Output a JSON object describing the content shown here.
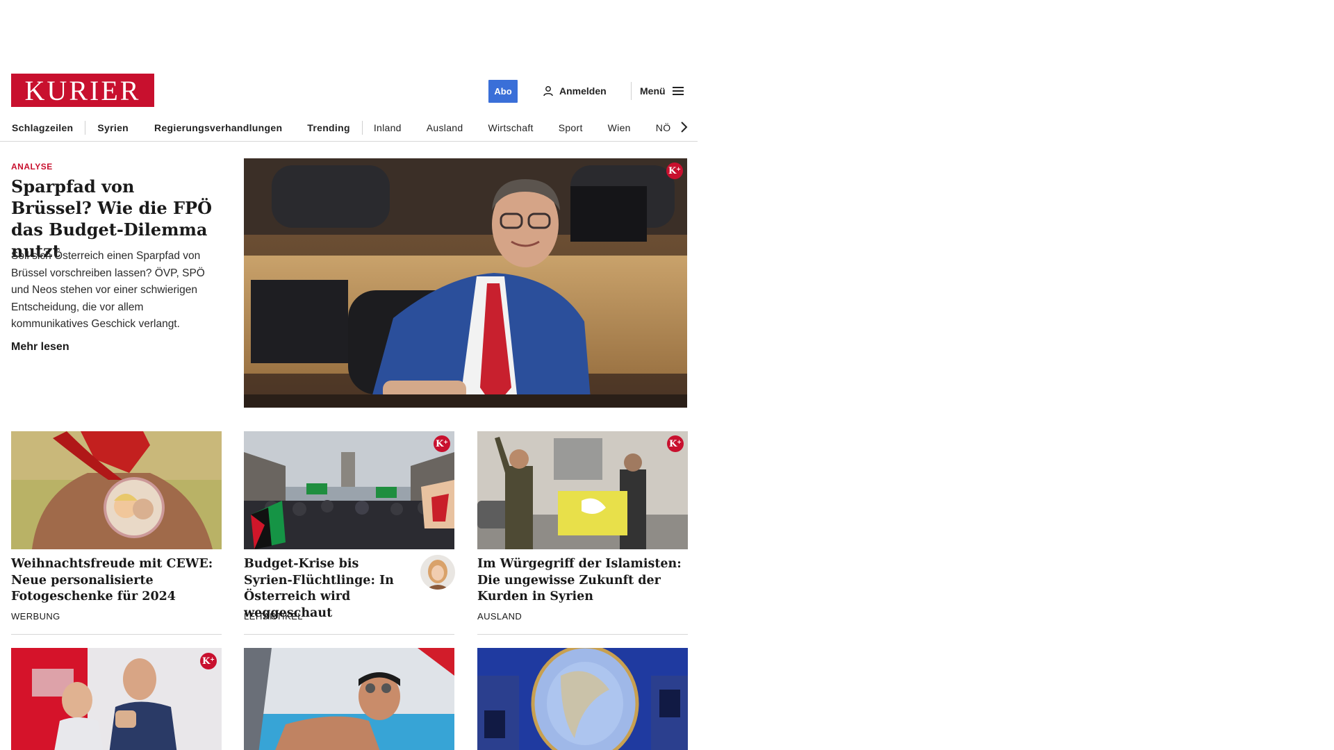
{
  "header": {
    "logo_text": "KURIER",
    "abo_label": "Abo",
    "login_label": "Anmelden",
    "menu_label": "Menü"
  },
  "nav": {
    "items": [
      "Schlagzeilen",
      "Syrien",
      "Regierungsverhandlungen",
      "Trending",
      "Inland",
      "Ausland",
      "Wirtschaft",
      "Sport",
      "Wien",
      "NÖ"
    ]
  },
  "lead": {
    "kicker": "ANALYSE",
    "title": "Sparpfad von Brüssel? Wie die FPÖ das Budget-Dilemma nutzt",
    "teaser": "Soll sich Österreich einen Sparpfad von Brüssel vorschreiben lassen? ÖVP, SPÖ und Neos stehen vor einer schwierigen Entscheidung, die vor allem kommunikatives Geschick verlangt.",
    "more_label": "Mehr lesen",
    "premium_badge": "K+"
  },
  "cards": [
    {
      "title": "Weihnachtsfreude mit CEWE: Neue personalisierte Fotogeschenke für 2024",
      "rubric": "WERBUNG",
      "premium": false
    },
    {
      "title": "Budget-Krise bis Syrien-Flüchtlinge: In Österreich wird weggeschaut",
      "rubric": "LEITARTIKEL",
      "premium": true
    },
    {
      "title": "Im Würgegriff der Islamisten: Die ungewisse Zukunft der Kurden in Syrien",
      "rubric": "AUSLAND",
      "premium": true
    }
  ],
  "colors": {
    "brand_red": "#c8102e",
    "abo_blue": "#3a6fd8",
    "text": "#1a1a1a"
  },
  "icons": {
    "login": "person-icon",
    "menu": "hamburger-icon",
    "nav_next": "chevron-right-icon",
    "premium": "kurier-plus-badge"
  }
}
